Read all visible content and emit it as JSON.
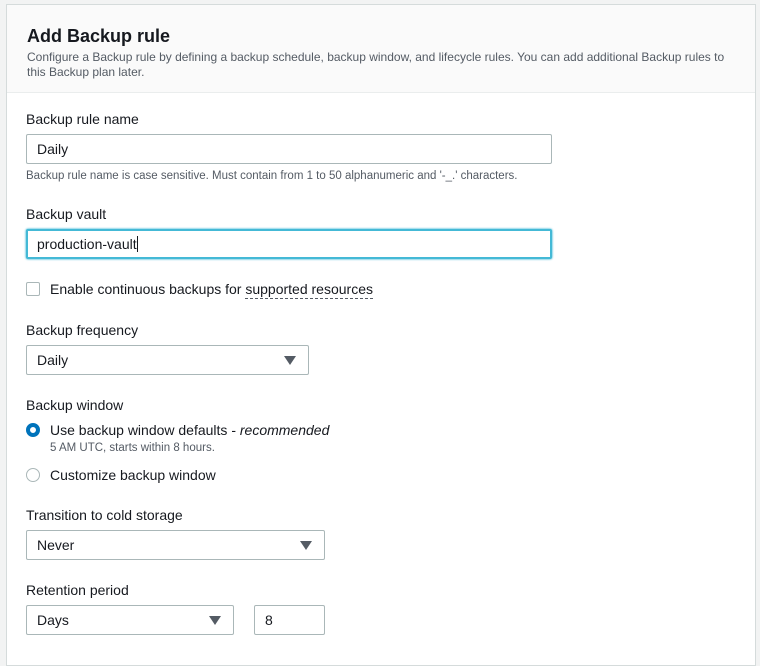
{
  "header": {
    "title": "Add Backup rule",
    "description": "Configure a Backup rule by defining a backup schedule, backup window, and lifecycle rules. You can add additional Backup rules to this Backup plan later."
  },
  "rule_name": {
    "label": "Backup rule name",
    "value": "Daily",
    "hint": "Backup rule name is case sensitive. Must contain from 1 to 50 alphanumeric and '-_.' characters."
  },
  "vault": {
    "label": "Backup vault",
    "value": "production-vault"
  },
  "continuous": {
    "label": "Enable continuous backups for ",
    "link": "supported resources",
    "checked": false
  },
  "frequency": {
    "label": "Backup frequency",
    "value": "Daily"
  },
  "window": {
    "label": "Backup window",
    "option_default": "Use backup window defaults - ",
    "option_default_emph": "recommended",
    "option_default_hint": "5 AM UTC, starts within 8 hours.",
    "option_custom": "Customize backup window",
    "selected": "default"
  },
  "cold_storage": {
    "label": "Transition to cold storage",
    "value": "Never"
  },
  "retention": {
    "label": "Retention period",
    "unit": "Days",
    "value": "8"
  },
  "colors": {
    "accent": "#0073bb",
    "focus": "#44b9d6"
  }
}
